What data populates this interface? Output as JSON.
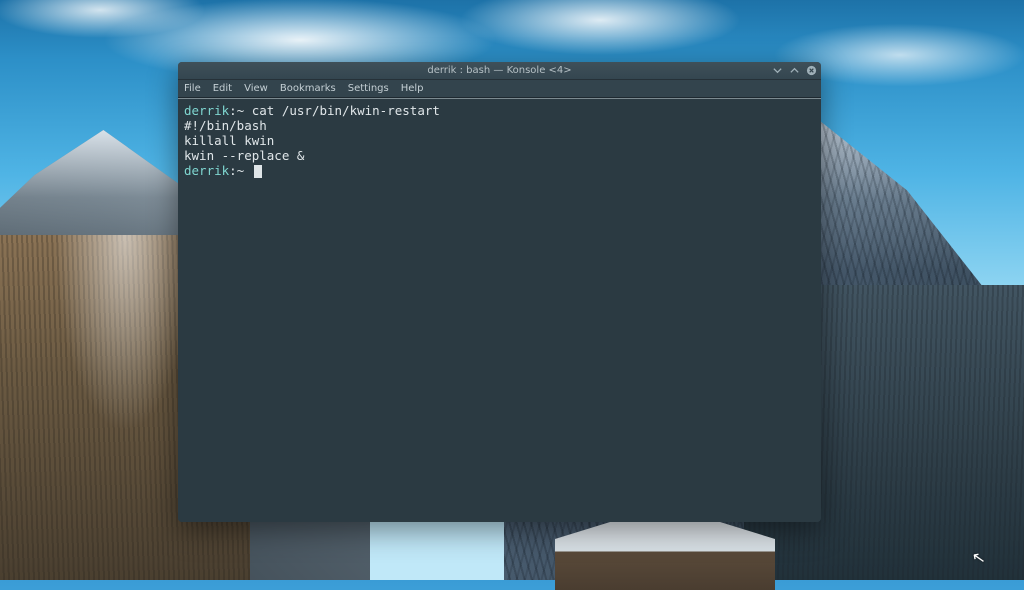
{
  "window": {
    "title": "derrik : bash — Konsole <4>",
    "menu": {
      "file": "File",
      "edit": "Edit",
      "view": "View",
      "bookmarks": "Bookmarks",
      "settings": "Settings",
      "help": "Help"
    }
  },
  "terminal": {
    "prompt_user": "derrik",
    "prompt_sep": ":~",
    "command": "cat /usr/bin/kwin-restart",
    "output": [
      "#!/bin/bash",
      "killall kwin",
      "kwin --replace &"
    ]
  }
}
